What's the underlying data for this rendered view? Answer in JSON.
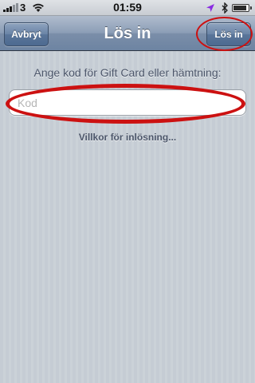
{
  "status_bar": {
    "carrier": "3",
    "time": "01:59",
    "battery_level": 0.88
  },
  "nav": {
    "title": "Lös in",
    "cancel_label": "Avbryt",
    "signin_label": "Lös in"
  },
  "content": {
    "prompt": "Ange kod för Gift Card eller hämtning:",
    "code_placeholder": "Kod",
    "code_value": "",
    "terms_link": "Villkor för inlösning..."
  },
  "colors": {
    "annotation": "#cc1111",
    "nav_bar": "#7b8ea9",
    "background": "#c5ccd4"
  },
  "icons": [
    "signal-icon",
    "wifi-icon",
    "location-arrow-icon",
    "bluetooth-icon",
    "battery-icon"
  ]
}
